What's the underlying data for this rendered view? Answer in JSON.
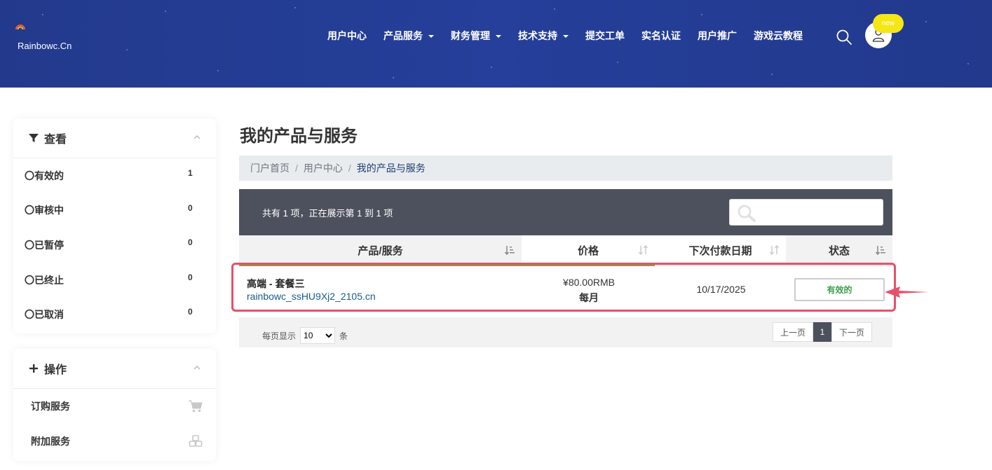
{
  "brand": {
    "name": "Rainbowc.Cn"
  },
  "nav": {
    "items": [
      {
        "label": "用户中心",
        "dropdown": false
      },
      {
        "label": "产品服务",
        "dropdown": true
      },
      {
        "label": "财务管理",
        "dropdown": true
      },
      {
        "label": "技术支持",
        "dropdown": true
      },
      {
        "label": "提交工单",
        "dropdown": false
      },
      {
        "label": "实名认证",
        "dropdown": false
      },
      {
        "label": "用户推广",
        "dropdown": false
      },
      {
        "label": "游戏云教程",
        "dropdown": false
      }
    ],
    "new_badge": "new"
  },
  "sidebar": {
    "filter": {
      "title": "查看",
      "items": [
        {
          "label": "〇有效的",
          "count": "1"
        },
        {
          "label": "〇审核中",
          "count": "0"
        },
        {
          "label": "〇已暂停",
          "count": "0"
        },
        {
          "label": "〇已终止",
          "count": "0"
        },
        {
          "label": "〇已取消",
          "count": "0"
        }
      ]
    },
    "actions": {
      "title": "操作",
      "items": [
        {
          "label": "订购服务",
          "icon": "cart-icon"
        },
        {
          "label": "附加服务",
          "icon": "cubes-icon"
        }
      ]
    }
  },
  "main": {
    "title": "我的产品与服务",
    "breadcrumb": [
      "门户首页",
      "用户中心",
      "我的产品与服务"
    ],
    "table_info": "共有 1 项，正在展示第 1 到 1 项",
    "columns": [
      "产品/服务",
      "价格",
      "下次付款日期",
      "状态"
    ],
    "rows": [
      {
        "product": "高端 - 套餐三",
        "domain": "rainbowc_ssHU9Xj2_2105.cn",
        "price": "¥80.00RMB",
        "cycle": "每月",
        "next_due": "10/17/2025",
        "status": "有效的"
      }
    ],
    "footer": {
      "per_page_label": "每页显示",
      "per_page_value": "10",
      "per_page_unit": "条",
      "prev": "上一页",
      "current_page": "1",
      "next": "下一页"
    }
  },
  "colors": {
    "header_bg": "#243c92",
    "toolbar_bg": "#4d515d",
    "status_active": "#3aa04a",
    "highlight": "#e8506a",
    "badge": "#f5e616"
  }
}
